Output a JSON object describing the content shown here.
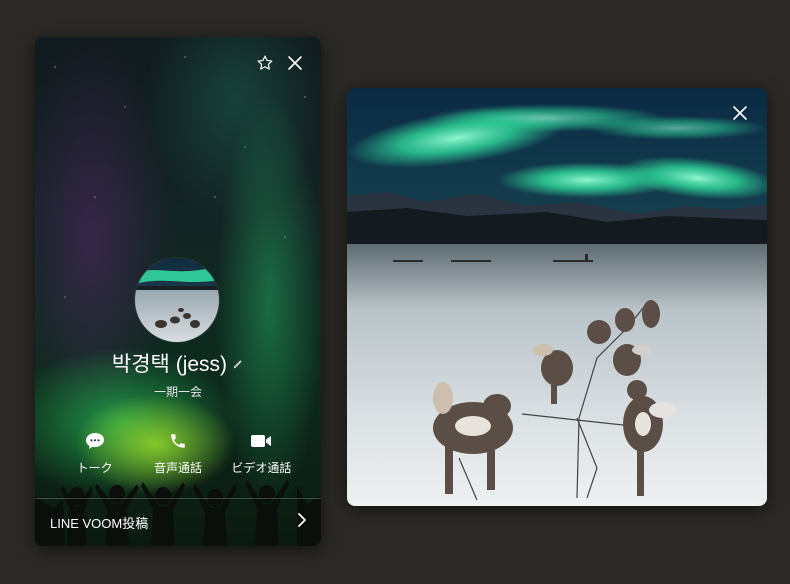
{
  "profile": {
    "name": "박경택 (jess)",
    "status_message": "一期一会",
    "actions": [
      {
        "label": "トーク",
        "icon": "chat-bubble-icon"
      },
      {
        "label": "音声通話",
        "icon": "phone-icon"
      },
      {
        "label": "ビデオ通話",
        "icon": "video-camera-icon"
      }
    ],
    "voom_label": "LINE VOOM投稿",
    "top_icons": [
      "star-icon",
      "close-icon"
    ]
  },
  "viewer": {
    "top_icons": [
      "close-icon"
    ]
  },
  "colors": {
    "background": "#2a2925",
    "text": "#ffffff",
    "aurora_green": "#2fd89a"
  }
}
